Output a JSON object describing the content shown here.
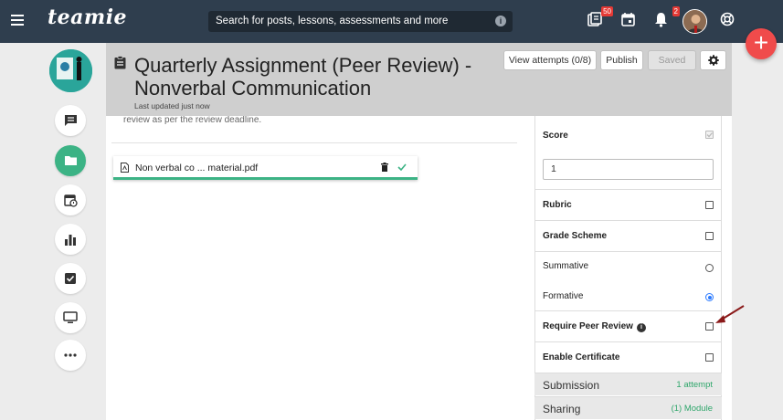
{
  "topbar": {
    "logo": "teamie",
    "search_placeholder": "Search for posts, lessons, assessments and more",
    "posts_badge": "50",
    "notifications_badge": "2"
  },
  "page": {
    "title": "Quarterly Assignment (Peer Review) - Nonverbal Communication",
    "updated": "Last updated just now",
    "buttons": {
      "view_attempts": "View attempts (0/8)",
      "publish": "Publish",
      "saved": "Saved"
    },
    "description": "review as per the review deadline.",
    "file_name": "Non verbal co ... material.pdf"
  },
  "settings": {
    "score_label": "Score",
    "score_value": "1",
    "rubric": "Rubric",
    "grade_scheme": "Grade Scheme",
    "summative": "Summative",
    "formative": "Formative",
    "require_peer_review": "Require Peer Review",
    "enable_certificate": "Enable Certificate",
    "submission_label": "Submission",
    "submission_value": "1 attempt",
    "sharing_label": "Sharing",
    "sharing_value": "(1) Module",
    "selected_grade_type": "Formative",
    "score_checked": true
  },
  "colors": {
    "topbar": "#2f3e4e",
    "accent_green": "#3cb385",
    "fab_red": "#f04b4b",
    "arrow": "#8b1a1a"
  }
}
